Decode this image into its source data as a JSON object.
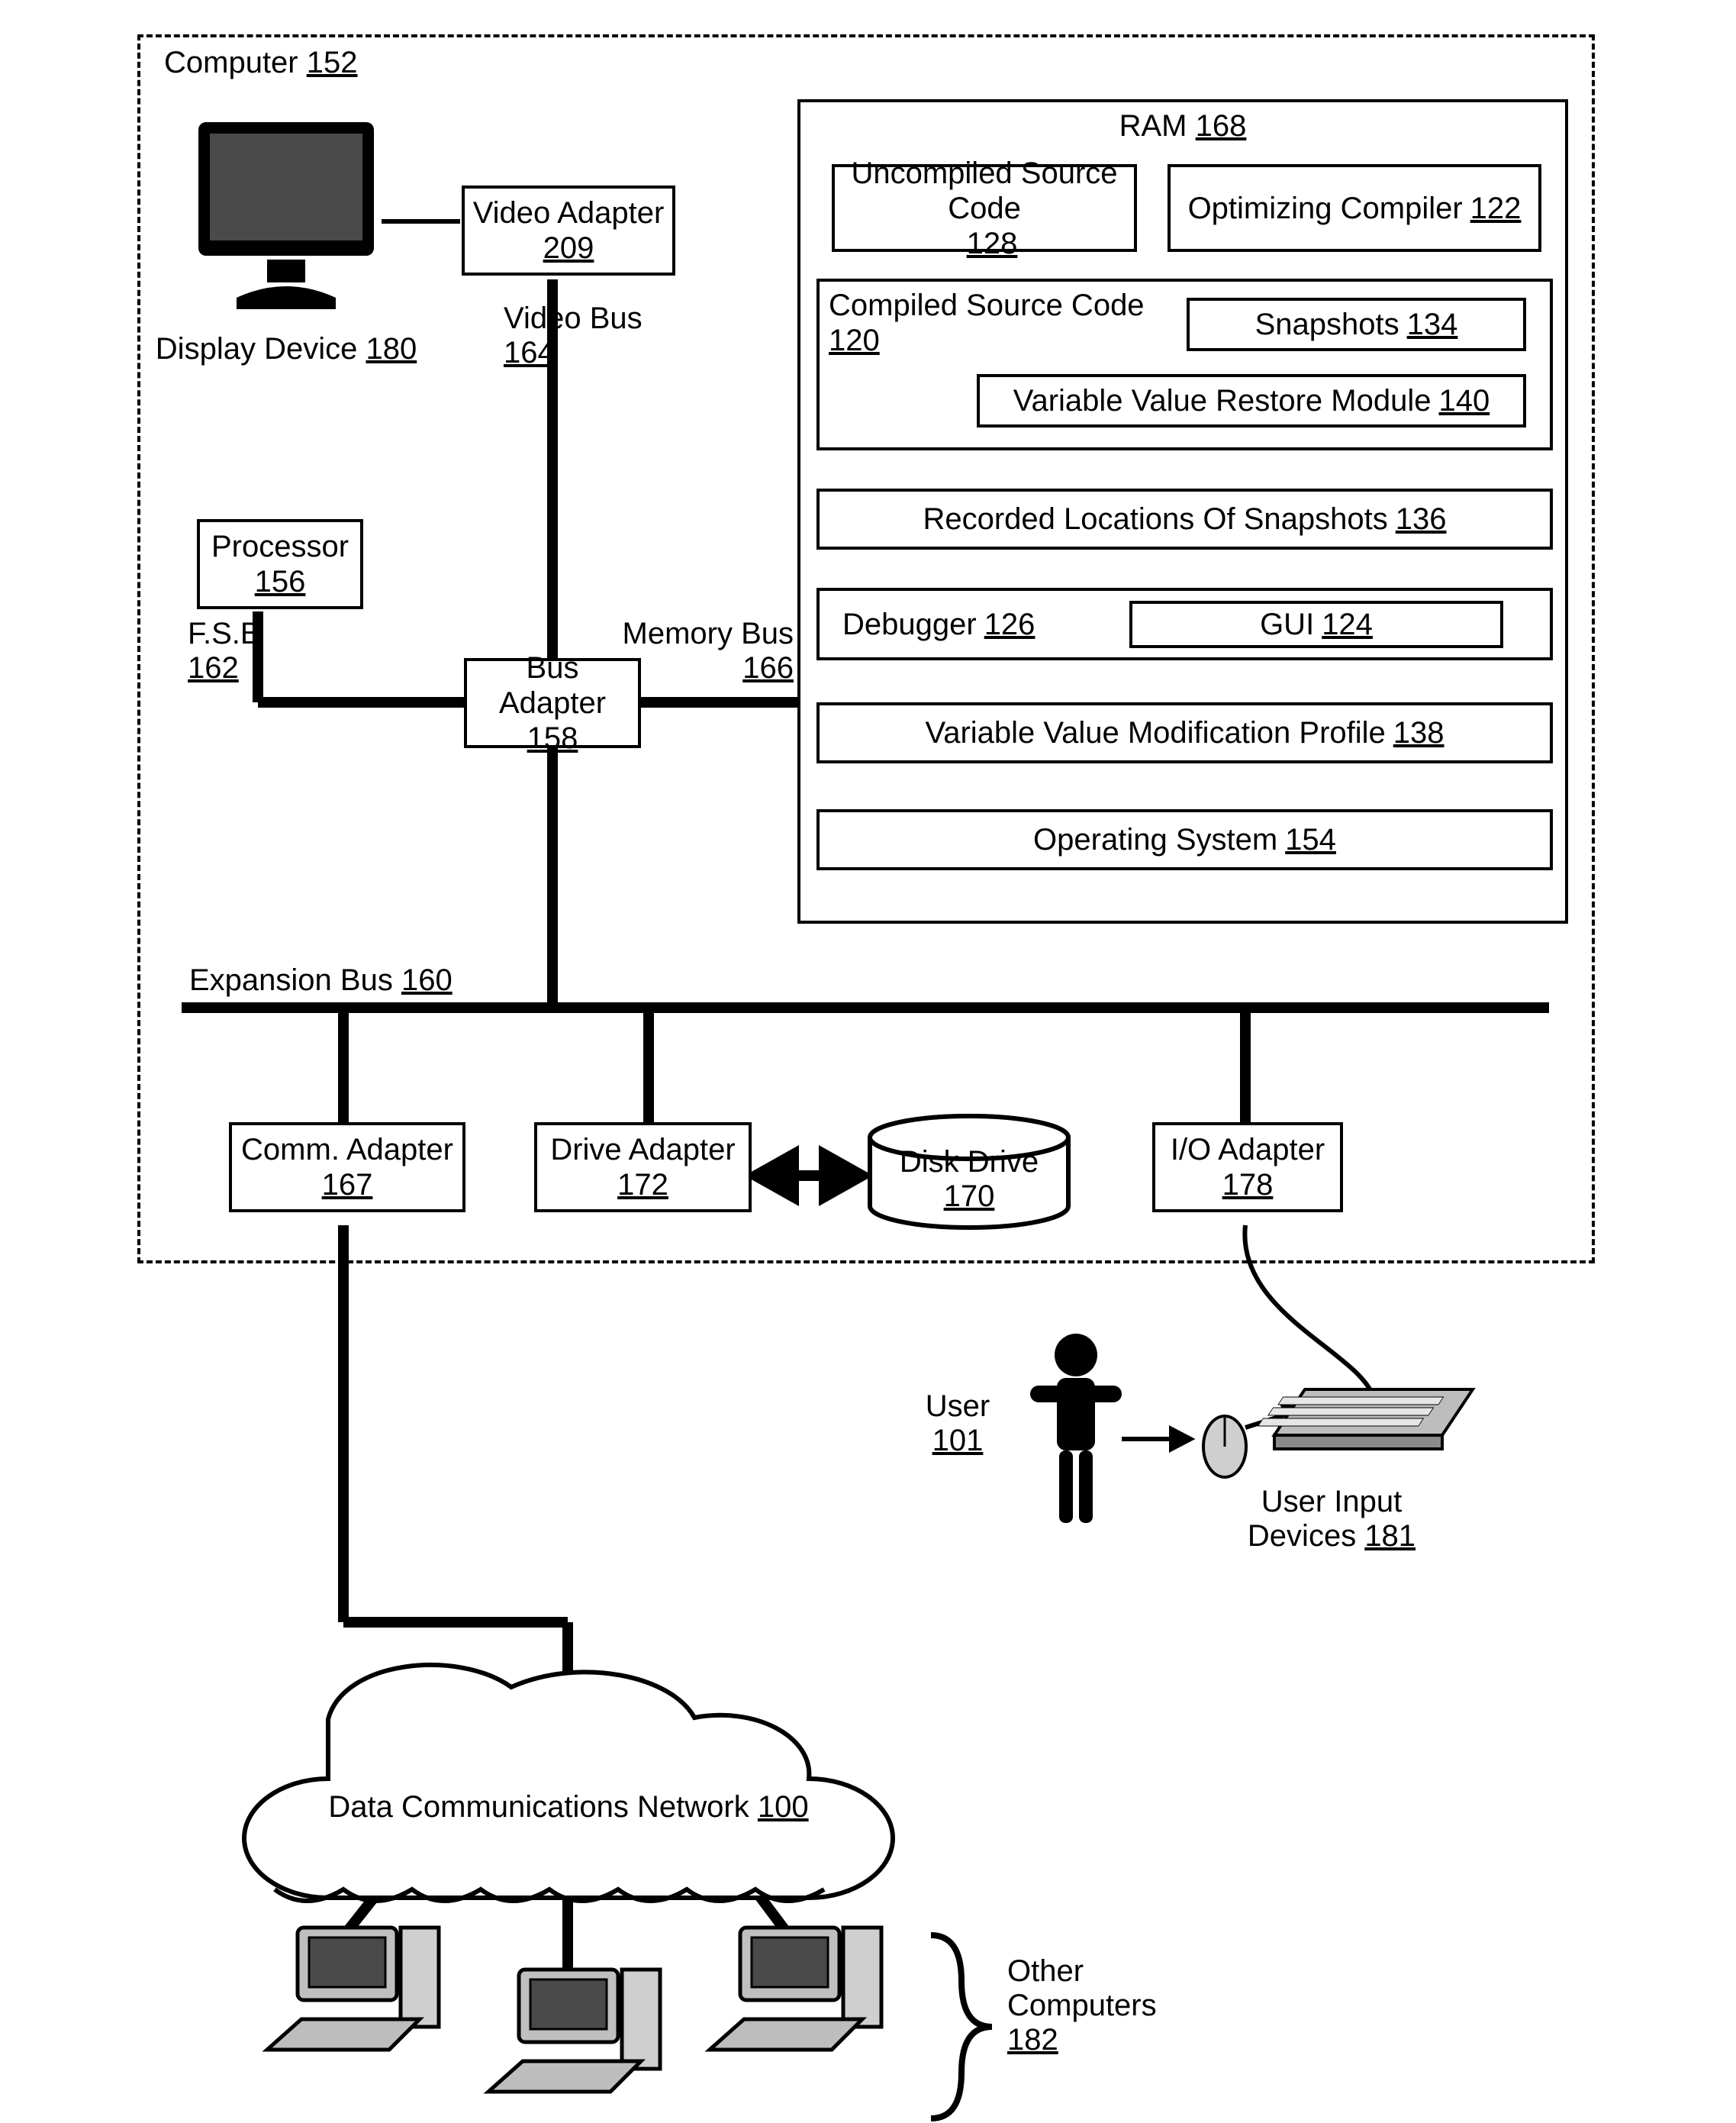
{
  "computer": {
    "label": "Computer",
    "ref": "152"
  },
  "display": {
    "label": "Display Device",
    "ref": "180"
  },
  "video_adapter": {
    "label": "Video Adapter",
    "ref": "209"
  },
  "video_bus": {
    "label": "Video Bus",
    "ref": "164"
  },
  "processor": {
    "label": "Processor",
    "ref": "156"
  },
  "fsb": {
    "label": "F.S.B",
    "ref": "162"
  },
  "bus_adapter": {
    "label": "Bus Adapter",
    "ref": "158"
  },
  "memory_bus": {
    "label": "Memory Bus",
    "ref": "166"
  },
  "ram": {
    "label": "RAM",
    "ref": "168"
  },
  "uncompiled": {
    "label": "Uncompiled Source Code",
    "ref": "128"
  },
  "optimizer": {
    "label": "Optimizing Compiler",
    "ref": "122"
  },
  "compiled": {
    "label": "Compiled Source Code",
    "ref": "120"
  },
  "snapshots": {
    "label": "Snapshots",
    "ref": "134"
  },
  "restore": {
    "label": "Variable Value Restore Module",
    "ref": "140"
  },
  "rec_locations": {
    "label": "Recorded Locations Of Snapshots",
    "ref": "136"
  },
  "debugger": {
    "label": "Debugger",
    "ref": "126"
  },
  "gui": {
    "label": "GUI",
    "ref": "124"
  },
  "vvmp": {
    "label": "Variable Value Modification Profile",
    "ref": "138"
  },
  "os": {
    "label": "Operating System",
    "ref": "154"
  },
  "expansion_bus": {
    "label": "Expansion Bus",
    "ref": "160"
  },
  "comm_adapter": {
    "label": "Comm. Adapter",
    "ref": "167"
  },
  "drive_adapter": {
    "label": "Drive Adapter",
    "ref": "172"
  },
  "disk_drive": {
    "label": "Disk Drive",
    "ref": "170"
  },
  "io_adapter": {
    "label": "I/O Adapter",
    "ref": "178"
  },
  "user": {
    "label": "User",
    "ref": "101"
  },
  "input_devices": {
    "label": "User Input Devices",
    "ref": "181"
  },
  "network": {
    "label": "Data Communications Network",
    "ref": "100"
  },
  "other_computers": {
    "label": "Other Computers",
    "ref": "182"
  }
}
